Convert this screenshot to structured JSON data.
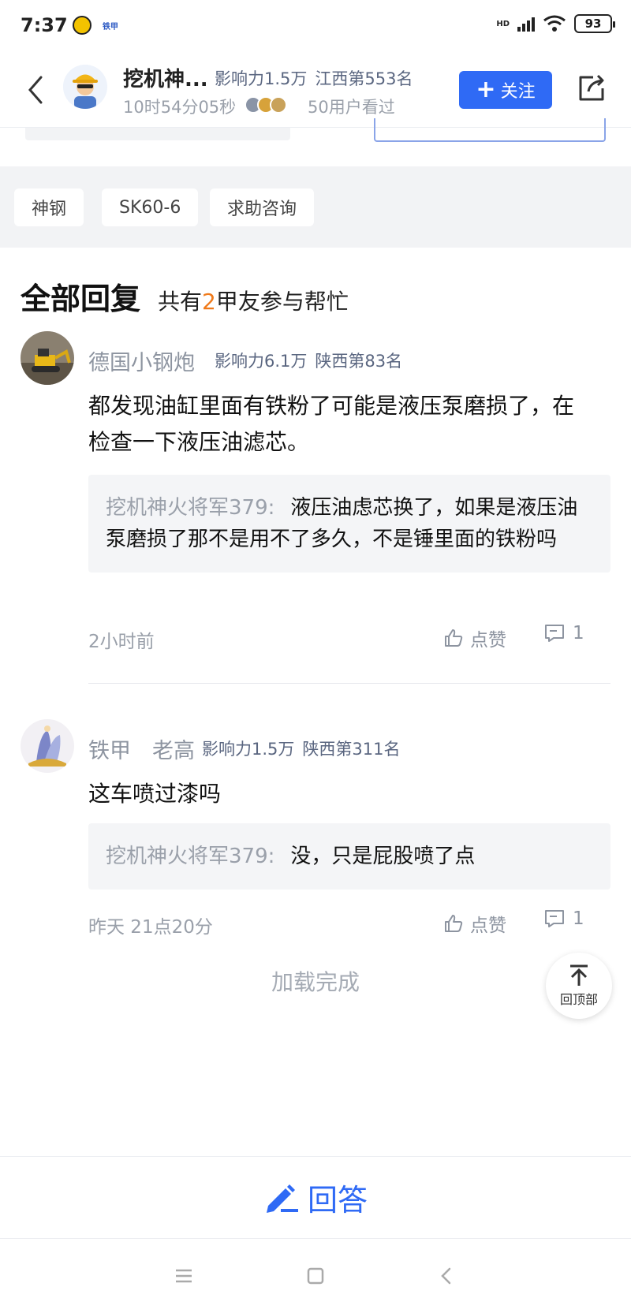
{
  "status_bar": {
    "time": "7:37",
    "app_label": "铁甲",
    "network": "HD",
    "battery": "93"
  },
  "header": {
    "author_name": "挖机神...",
    "influence": "影响力1.5万",
    "rank": "江西第553名",
    "timer": "10时54分05秒",
    "views": "50用户看过",
    "follow_label": "关注"
  },
  "tags": [
    "神钢",
    "SK60-6",
    "求助咨询"
  ],
  "replies": {
    "title": "全部回复",
    "count_prefix": "共有",
    "count": "2",
    "count_suffix": "甲友参与帮忙"
  },
  "comments": [
    {
      "name": "德国小钢炮",
      "influence": "影响力6.1万",
      "rank": "陕西第83名",
      "body": " 都发现油缸里面有铁粉了可能是液压泵磨损了，在检查一下液压油滤芯。",
      "quote_author": "挖机神火将军379:",
      "quote_text": "液压油虑芯换了，如果是液压油泵磨损了那不是用不了多久，不是锤里面的铁粉吗",
      "time": "2小时前",
      "like_label": "点赞",
      "reply_count": "1"
    },
    {
      "name": "铁甲　老高",
      "influence": "影响力1.5万",
      "rank": "陕西第311名",
      "body": " 这车喷过漆吗",
      "quote_author": "挖机神火将军379:",
      "quote_text": "没，只是屁股喷了点",
      "time": "昨天 21点20分",
      "like_label": "点赞",
      "reply_count": "1"
    }
  ],
  "loaded_text": "加载完成",
  "back_to_top_label": "回顶部",
  "answer_label": "回答",
  "colors": {
    "accent": "#2f6af5",
    "count_highlight": "#f07a1a",
    "meta_text": "#5a6680",
    "muted_text": "#9aa0aa"
  },
  "icons": [
    "back-arrow-icon",
    "share-icon",
    "plus-icon",
    "thumbs-up-icon",
    "comment-icon",
    "arrow-up-icon",
    "pen-icon",
    "menu-icon",
    "home-square-icon",
    "nav-back-icon",
    "signal-icon",
    "wifi-icon",
    "battery-icon"
  ]
}
